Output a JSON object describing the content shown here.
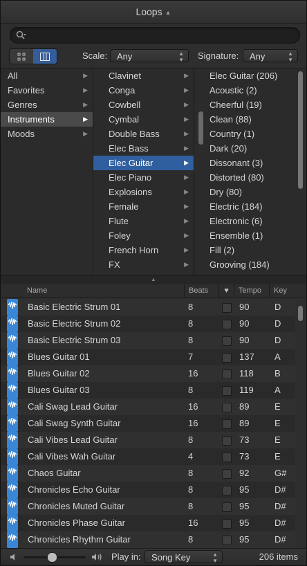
{
  "window": {
    "title": "Loops"
  },
  "search": {
    "placeholder": "",
    "value": ""
  },
  "toolbar": {
    "scale_label": "Scale:",
    "scale_value": "Any",
    "signature_label": "Signature:",
    "signature_value": "Any"
  },
  "browser": {
    "column1": [
      {
        "label": "All",
        "state": "normal"
      },
      {
        "label": "Favorites",
        "state": "normal"
      },
      {
        "label": "Genres",
        "state": "normal"
      },
      {
        "label": "Instruments",
        "state": "selected"
      },
      {
        "label": "Moods",
        "state": "normal"
      }
    ],
    "column2": [
      {
        "label": "Clavinet",
        "state": "normal"
      },
      {
        "label": "Conga",
        "state": "normal"
      },
      {
        "label": "Cowbell",
        "state": "normal"
      },
      {
        "label": "Cymbal",
        "state": "normal"
      },
      {
        "label": "Double Bass",
        "state": "normal"
      },
      {
        "label": "Elec Bass",
        "state": "normal"
      },
      {
        "label": "Elec Guitar",
        "state": "selected"
      },
      {
        "label": "Elec Piano",
        "state": "normal"
      },
      {
        "label": "Explosions",
        "state": "normal"
      },
      {
        "label": "Female",
        "state": "normal"
      },
      {
        "label": "Flute",
        "state": "normal"
      },
      {
        "label": "Foley",
        "state": "normal"
      },
      {
        "label": "French Horn",
        "state": "normal"
      },
      {
        "label": "FX",
        "state": "normal"
      }
    ],
    "column3": [
      "Elec Guitar (206)",
      "Acoustic (2)",
      "Cheerful (19)",
      "Clean (88)",
      "Country (1)",
      "Dark (20)",
      "Dissonant (3)",
      "Distorted (80)",
      "Dry (80)",
      "Electric (184)",
      "Electronic (6)",
      "Ensemble (1)",
      "Fill (2)",
      "Grooving (184)"
    ]
  },
  "table": {
    "headers": {
      "name": "Name",
      "beats": "Beats",
      "tempo": "Tempo",
      "key": "Key"
    },
    "rows": [
      {
        "name": "Basic Electric Strum 01",
        "beats": "8",
        "tempo": "90",
        "key": "D"
      },
      {
        "name": "Basic Electric Strum 02",
        "beats": "8",
        "tempo": "90",
        "key": "D"
      },
      {
        "name": "Basic Electric Strum 03",
        "beats": "8",
        "tempo": "90",
        "key": "D"
      },
      {
        "name": "Blues Guitar 01",
        "beats": "7",
        "tempo": "137",
        "key": "A"
      },
      {
        "name": "Blues Guitar 02",
        "beats": "16",
        "tempo": "118",
        "key": "B"
      },
      {
        "name": "Blues Guitar 03",
        "beats": "8",
        "tempo": "119",
        "key": "A"
      },
      {
        "name": "Cali Swag Lead Guitar",
        "beats": "16",
        "tempo": "89",
        "key": "E"
      },
      {
        "name": "Cali Swag Synth Guitar",
        "beats": "16",
        "tempo": "89",
        "key": "E"
      },
      {
        "name": "Cali Vibes Lead Guitar",
        "beats": "8",
        "tempo": "73",
        "key": "E"
      },
      {
        "name": "Cali Vibes Wah Guitar",
        "beats": "4",
        "tempo": "73",
        "key": "E"
      },
      {
        "name": "Chaos Guitar",
        "beats": "8",
        "tempo": "92",
        "key": "G#"
      },
      {
        "name": "Chronicles Echo Guitar",
        "beats": "8",
        "tempo": "95",
        "key": "D#"
      },
      {
        "name": "Chronicles Muted Guitar",
        "beats": "8",
        "tempo": "95",
        "key": "D#"
      },
      {
        "name": "Chronicles Phase Guitar",
        "beats": "16",
        "tempo": "95",
        "key": "D#"
      },
      {
        "name": "Chronicles Rhythm Guitar",
        "beats": "8",
        "tempo": "95",
        "key": "D#"
      }
    ]
  },
  "footer": {
    "play_in_label": "Play in:",
    "play_in_value": "Song Key",
    "item_count": "206 items",
    "volume_level": 0.45
  },
  "colors": {
    "accent": "#2f5f9f",
    "loop_icon": "#3a86d6"
  }
}
